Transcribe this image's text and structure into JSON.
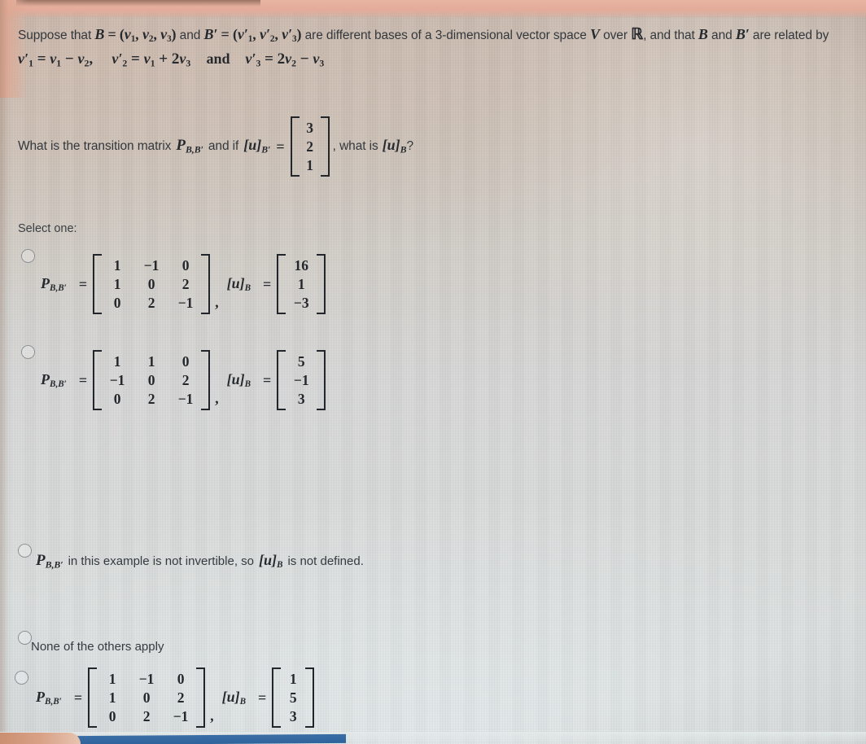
{
  "question": {
    "stem_line1_a": "Suppose that",
    "stem_B": "B",
    "stem_eq": "=",
    "stem_basis_B": "(v",
    "stem_line1_b": "and",
    "stem_Bprime": "B′",
    "stem_line1_c": "are different bases of a 3-dimensional vector space",
    "stem_V": "V",
    "stem_line1_d": "over",
    "stem_R": "ℝ",
    "stem_line1_e": ", and that",
    "stem_line1_f": "and",
    "stem_line1_g": "are related by",
    "relations": [
      "v′₁ = v₁ − v₂,",
      "v′₂ = v₁ + 2v₃",
      "and",
      "v′₃ = 2v₂ − v₃"
    ],
    "prompt_a": "What is the transition matrix",
    "prompt_P": "P",
    "prompt_P_sub": "B,B′",
    "prompt_b": "and if",
    "prompt_u_Bprime": "[u]",
    "prompt_u_Bprime_sub": "B′",
    "prompt_c": ", what is",
    "prompt_u_B": "[u]",
    "prompt_u_B_sub": "B",
    "prompt_d": "?",
    "given_vector": [
      "3",
      "2",
      "1"
    ]
  },
  "select_one_label": "Select one:",
  "options": [
    {
      "id": "option-a",
      "kind": "matrix",
      "selected": false,
      "matrix_label": "P",
      "matrix_label_sub": "B,B′",
      "equals": "=",
      "matrix": [
        [
          "1",
          "−1",
          "0"
        ],
        [
          "1",
          "0",
          "2"
        ],
        [
          "0",
          "2",
          "−1"
        ]
      ],
      "separator": ",",
      "vector_label": "[u]",
      "vector_label_sub": "B",
      "vector": [
        "16",
        "1",
        "−3"
      ]
    },
    {
      "id": "option-b",
      "kind": "matrix",
      "selected": false,
      "matrix_label": "P",
      "matrix_label_sub": "B,B′",
      "equals": "=",
      "matrix": [
        [
          "1",
          "1",
          "0"
        ],
        [
          "−1",
          "0",
          "2"
        ],
        [
          "0",
          "2",
          "−1"
        ]
      ],
      "separator": ",",
      "vector_label": "[u]",
      "vector_label_sub": "B",
      "vector": [
        "5",
        "−1",
        "3"
      ]
    },
    {
      "id": "option-c",
      "kind": "text",
      "selected": false,
      "text_P": "P",
      "text_P_sub": "B,B′",
      "text_a": "in this example is not invertible, so",
      "text_u": "[u]",
      "text_u_sub": "B",
      "text_b": "is not defined."
    },
    {
      "id": "option-d",
      "kind": "plain",
      "selected": false,
      "label": "None of the others apply"
    },
    {
      "id": "option-e",
      "kind": "matrix",
      "selected": false,
      "matrix_label": "P",
      "matrix_label_sub": "B,B′",
      "equals": "=",
      "matrix": [
        [
          "1",
          "−1",
          "0"
        ],
        [
          "1",
          "0",
          "2"
        ],
        [
          "0",
          "2",
          "−1"
        ]
      ],
      "separator": ",",
      "vector_label": "[u]",
      "vector_label_sub": "B",
      "vector": [
        "1",
        "5",
        "3"
      ]
    }
  ],
  "colors": {
    "text": "#2f3337",
    "screen_warm": "#cdc3b9",
    "screen_cool": "#e0e4e4",
    "taskbar_blue": "#3a6ea5",
    "edge_salmon": "#e3ab99"
  }
}
